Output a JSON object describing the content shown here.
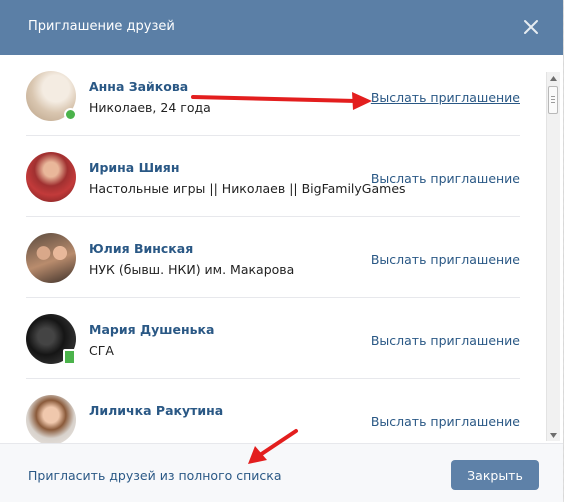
{
  "dialog": {
    "title": "Приглашение друзей"
  },
  "friends": [
    {
      "name": "Анна Зайкова",
      "subtitle": "Николаев, 24 года",
      "action": "Выслать приглашение",
      "status": "online"
    },
    {
      "name": "Ирина Шиян",
      "subtitle": "Настольные игры || Николаев || BigFamilyGames",
      "action": "Выслать приглашение",
      "status": "none"
    },
    {
      "name": "Юлия Винская",
      "subtitle": "НУК (бывш. НКИ) им. Макарова",
      "action": "Выслать приглашение",
      "status": "none"
    },
    {
      "name": "Мария Душенька",
      "subtitle": "СГА",
      "action": "Выслать приглашение",
      "status": "mobile"
    },
    {
      "name": "Лиличка Ракутина",
      "subtitle": "",
      "action": "Выслать приглашение",
      "status": "none"
    }
  ],
  "footer": {
    "invite_all_link": "Пригласить друзей из полного списка",
    "close_label": "Закрыть"
  },
  "colors": {
    "header": "#5b7fa6",
    "link": "#2a5885",
    "button": "#5e81a8",
    "online": "#4bb34b",
    "annotation_arrow": "#e31e1e"
  },
  "icons": {
    "close": "close-icon",
    "online": "online-indicator-icon",
    "mobile": "mobile-online-icon",
    "scroll_up": "scroll-up-arrow-icon",
    "scroll_down": "scroll-down-arrow-icon"
  }
}
